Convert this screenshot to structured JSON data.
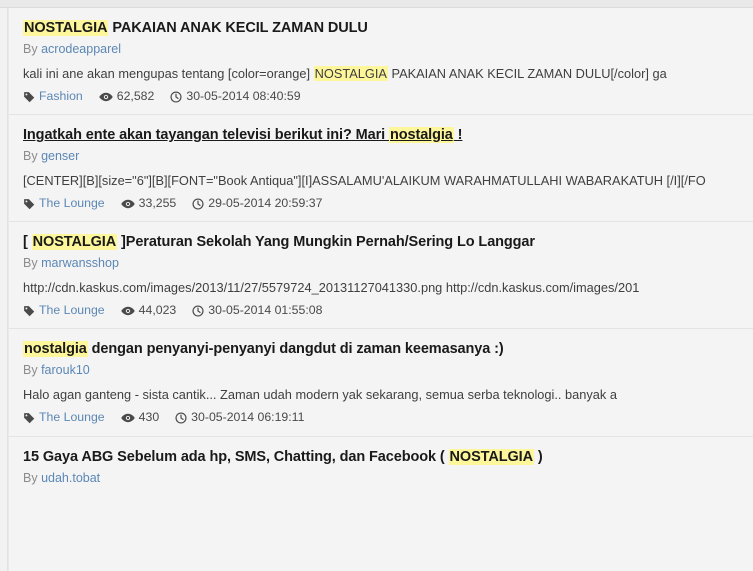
{
  "search": {
    "query_terms": [
      "NOSTALGIA",
      "nostalgia"
    ],
    "highlight_color": "#fdf69a",
    "link_color": "#5b87b5"
  },
  "icons": {
    "tag": "tag-icon",
    "views": "eye-icon",
    "time": "clock-icon"
  },
  "labels": {
    "by": "By"
  },
  "results": [
    {
      "title_parts": [
        {
          "text": "NOSTALGIA",
          "highlight": true
        },
        {
          "text": " PAKAIAN ANAK KECIL ZAMAN DULU",
          "highlight": false
        }
      ],
      "title_plain": "NOSTALGIA PAKAIAN ANAK KECIL ZAMAN DULU",
      "author": "acrodeapparel",
      "snippet_parts": [
        {
          "text": "kali ini ane akan mengupas tentang [color=orange] ",
          "highlight": false
        },
        {
          "text": "NOSTALGIA",
          "highlight": true
        },
        {
          "text": " PAKAIAN ANAK KECIL ZAMAN DULU[/color] ga",
          "highlight": false
        }
      ],
      "snippet_plain": "kali ini ane akan mengupas tentang [color=orange] NOSTALGIA PAKAIAN ANAK KECIL ZAMAN DULU[/color] ga",
      "category": "Fashion",
      "views": "62,582",
      "timestamp": "30-05-2014 08:40:59",
      "hovered": false
    },
    {
      "title_parts": [
        {
          "text": "Ingatkah ente akan tayangan televisi berikut ini? Mari ",
          "highlight": false
        },
        {
          "text": "nostalgia",
          "highlight": true
        },
        {
          "text": " !",
          "highlight": false
        }
      ],
      "title_plain": "Ingatkah ente akan tayangan televisi berikut ini? Mari nostalgia !",
      "author": "genser",
      "snippet_parts": [
        {
          "text": "[CENTER][B][size=\"6\"][B][FONT=\"Book Antiqua\"][I]ASSALAMU'ALAIKUM WARAHMATULLAHI WABARAKATUH [/I][/FO",
          "highlight": false
        }
      ],
      "snippet_plain": "[CENTER][B][size=\"6\"][B][FONT=\"Book Antiqua\"][I]ASSALAMU'ALAIKUM WARAHMATULLAHI WABARAKATUH [/I][/FO",
      "category": "The Lounge",
      "views": "33,255",
      "timestamp": "29-05-2014 20:59:37",
      "hovered": true
    },
    {
      "title_parts": [
        {
          "text": "[ ",
          "highlight": false
        },
        {
          "text": "NOSTALGIA",
          "highlight": true
        },
        {
          "text": " ]Peraturan Sekolah Yang Mungkin Pernah/Sering Lo Langgar",
          "highlight": false
        }
      ],
      "title_plain": "[ NOSTALGIA ]Peraturan Sekolah Yang Mungkin Pernah/Sering Lo Langgar",
      "author": "marwansshop",
      "snippet_parts": [
        {
          "text": "http://cdn.kaskus.com/images/2013/11/27/5579724_20131127041330.png http://cdn.kaskus.com/images/201",
          "highlight": false
        }
      ],
      "snippet_plain": "http://cdn.kaskus.com/images/2013/11/27/5579724_20131127041330.png http://cdn.kaskus.com/images/201",
      "category": "The Lounge",
      "views": "44,023",
      "timestamp": "30-05-2014 01:55:08",
      "hovered": false
    },
    {
      "title_parts": [
        {
          "text": "nostalgia",
          "highlight": true
        },
        {
          "text": " dengan penyanyi-penyanyi dangdut di zaman keemasanya :)",
          "highlight": false
        }
      ],
      "title_plain": "nostalgia dengan penyanyi-penyanyi dangdut di zaman keemasanya :)",
      "author": "farouk10",
      "snippet_parts": [
        {
          "text": "Halo agan ganteng - sista cantik... Zaman udah modern yak sekarang, semua serba teknologi.. banyak a",
          "highlight": false
        }
      ],
      "snippet_plain": "Halo agan ganteng - sista cantik... Zaman udah modern yak sekarang, semua serba teknologi.. banyak a",
      "category": "The Lounge",
      "views": "430",
      "timestamp": "30-05-2014 06:19:11",
      "hovered": false
    },
    {
      "title_parts": [
        {
          "text": "15 Gaya ABG Sebelum ada hp, SMS, Chatting, dan Facebook ( ",
          "highlight": false
        },
        {
          "text": "NOSTALGIA",
          "highlight": true
        },
        {
          "text": " )",
          "highlight": false
        }
      ],
      "title_plain": "15 Gaya ABG Sebelum ada hp, SMS, Chatting, dan Facebook ( NOSTALGIA )",
      "author": "udah.tobat",
      "snippet_parts": [],
      "snippet_plain": "",
      "category": "",
      "views": "",
      "timestamp": "",
      "hovered": false,
      "truncated": true
    }
  ]
}
